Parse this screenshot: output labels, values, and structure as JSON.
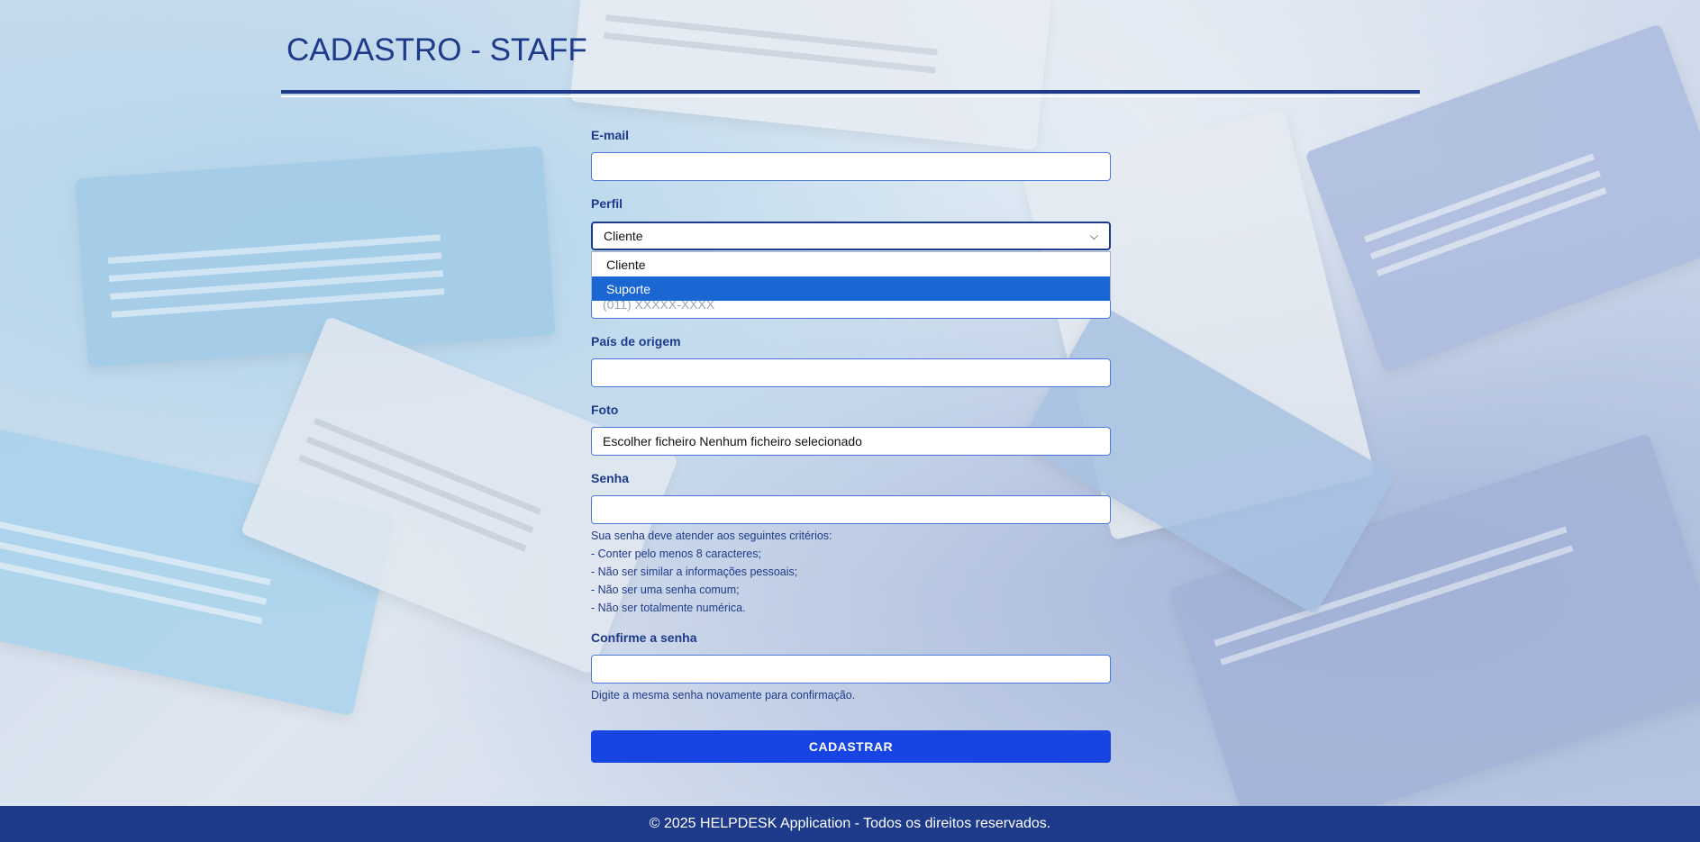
{
  "header": {
    "title": "CADASTRO - STAFF"
  },
  "form": {
    "email_label": "E-mail",
    "email_value": "",
    "perfil_label": "Perfil",
    "perfil_selected": "Cliente",
    "perfil_options": [
      "Cliente",
      "Suporte"
    ],
    "perfil_highlighted": "Suporte",
    "telefone_placeholder": "(011) XXXXX-XXXX",
    "pais_label": "País de origem",
    "pais_value": "",
    "foto_label": "Foto",
    "foto_button": "Escolher ficheiro",
    "foto_status": "Nenhum ficheiro selecionado",
    "senha_label": "Senha",
    "senha_value": "",
    "senha_hints": [
      "Sua senha deve atender aos seguintes critérios:",
      "- Conter pelo menos 8 caracteres;",
      "- Não ser similar a informações pessoais;",
      "- Não ser uma senha comum;",
      "- Não ser totalmente numérica."
    ],
    "confirm_label": "Confirme a senha",
    "confirm_value": "",
    "confirm_hint": "Digite a mesma senha novamente para confirmação.",
    "submit_label": "CADASTRAR"
  },
  "footer": {
    "text": "© 2025 HELPDESK Application - Todos os direitos reservados."
  },
  "colors": {
    "primary": "#1e3a8a",
    "button": "#1745e3",
    "highlight": "#1a66d2"
  }
}
